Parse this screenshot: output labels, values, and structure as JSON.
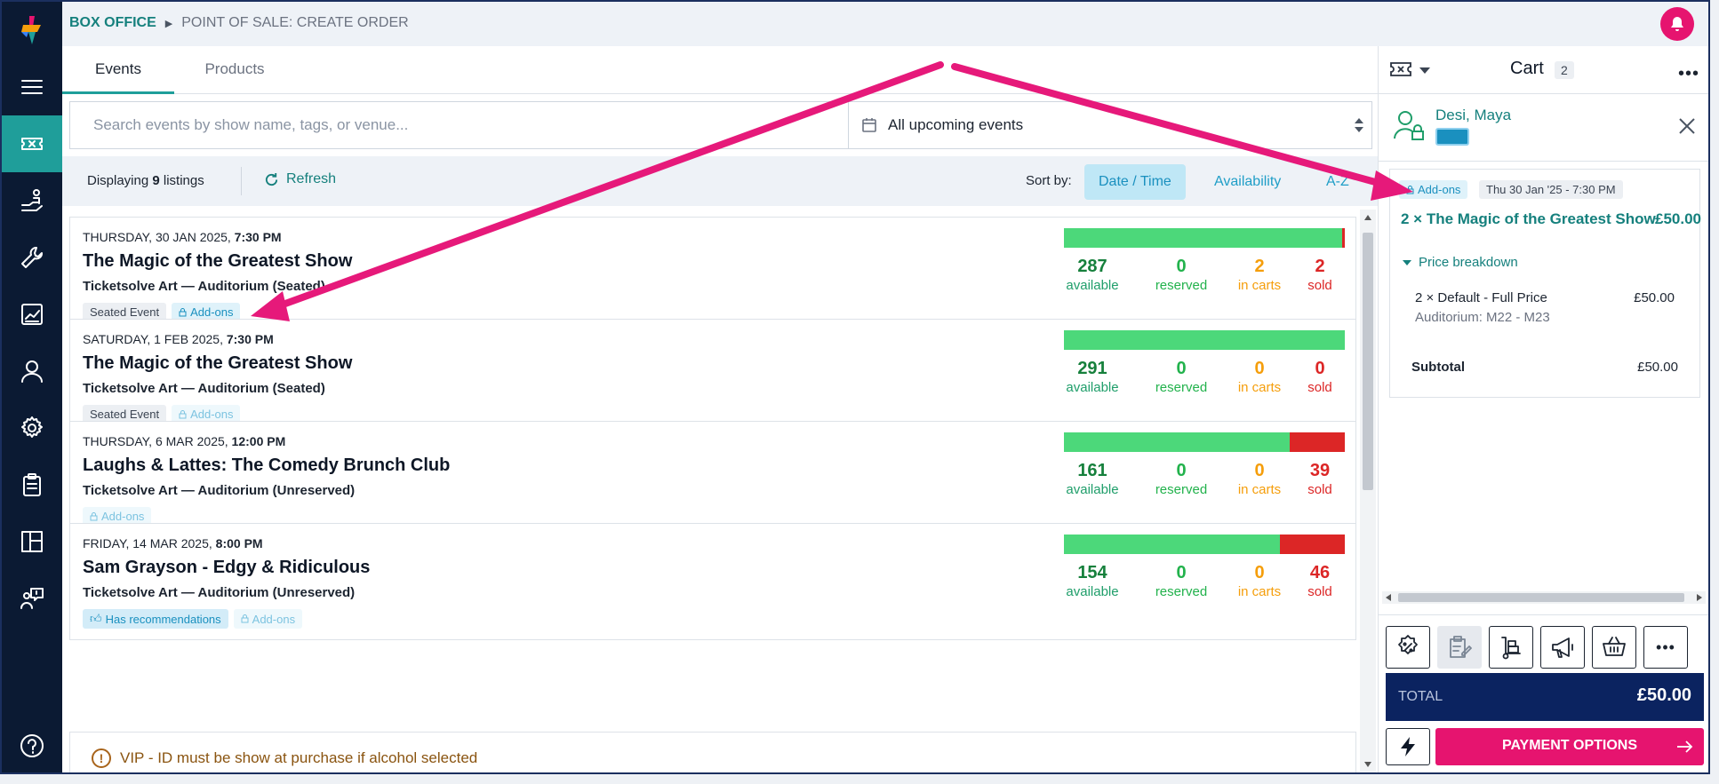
{
  "breadcrumb": {
    "root": "BOX OFFICE",
    "current": "POINT OF SALE: CREATE ORDER"
  },
  "tabs": [
    {
      "label": "Events"
    },
    {
      "label": "Products"
    }
  ],
  "search": {
    "placeholder": "Search events by show name, tags, or venue...",
    "value": ""
  },
  "filter": {
    "selected": "All upcoming events"
  },
  "listing": {
    "prefix": "Displaying",
    "count": "9",
    "suffix": "listings",
    "refresh_label": "Refresh",
    "sort_label": "Sort by:",
    "sort_options": [
      "Date / Time",
      "Availability",
      "A-Z"
    ]
  },
  "events": [
    {
      "date": "THURSDAY, 30 JAN 2025,",
      "time": "7:30 PM",
      "title": "The Magic of the Greatest Show",
      "venue": "Ticketsolve Art — Auditorium (Seated)",
      "tags": [
        "Seated Event",
        "Add-ons"
      ],
      "available": "287",
      "reserved": "0",
      "in_carts": "2",
      "sold": "2",
      "sold_fraction": 0.008
    },
    {
      "date": "SATURDAY, 1 FEB 2025,",
      "time": "7:30 PM",
      "title": "The Magic of the Greatest Show",
      "venue": "Ticketsolve Art — Auditorium (Seated)",
      "tags": [
        "Seated Event",
        "Add-ons"
      ],
      "available": "291",
      "reserved": "0",
      "in_carts": "0",
      "sold": "0",
      "sold_fraction": 0
    },
    {
      "date": "THURSDAY, 6 MAR 2025,",
      "time": "12:00 PM",
      "title": "Laughs & Lattes: The Comedy Brunch Club",
      "venue": "Ticketsolve Art — Auditorium (Unreserved)",
      "tags": [
        "Add-ons"
      ],
      "available": "161",
      "reserved": "0",
      "in_carts": "0",
      "sold": "39",
      "sold_fraction": 0.195
    },
    {
      "date": "FRIDAY, 14 MAR 2025,",
      "time": "8:00 PM",
      "title": "Sam Grayson - Edgy & Ridiculous",
      "venue": "Ticketsolve Art — Auditorium (Unreserved)",
      "tags": [
        "Has recommendations",
        "Add-ons"
      ],
      "available": "154",
      "reserved": "0",
      "in_carts": "0",
      "sold": "46",
      "sold_fraction": 0.23
    }
  ],
  "stat_labels": {
    "available": "available",
    "reserved": "reserved",
    "in_carts": "in carts",
    "sold": "sold"
  },
  "notice": {
    "icon": "!",
    "text": "VIP - ID must be show at purchase if alcohol selected"
  },
  "cart": {
    "title": "Cart",
    "count": "2",
    "more": "•••",
    "customer": "Desi, Maya",
    "item": {
      "tag": "Add-ons",
      "date": "Thu 30 Jan '25 - 7:30 PM",
      "title": "2 × The Magic of the Greatest Show",
      "price": "£50.00",
      "breakdown_label": "Price breakdown",
      "line_desc": "2 × Default - Full Price",
      "line_amount": "£50.00",
      "line_seats": "Auditorium: M22 - M23",
      "subtotal_label": "Subtotal",
      "subtotal_value": "£50.00"
    },
    "total_label": "TOTAL",
    "total_value": "£50.00",
    "pay_label": "PAYMENT OPTIONS",
    "action_more": "•••"
  },
  "colors": {
    "accent": "#1f9e9a",
    "brand_pink": "#e6146f",
    "navy": "#0b2360",
    "available": "#4cd87a",
    "sold": "#dc2626"
  }
}
